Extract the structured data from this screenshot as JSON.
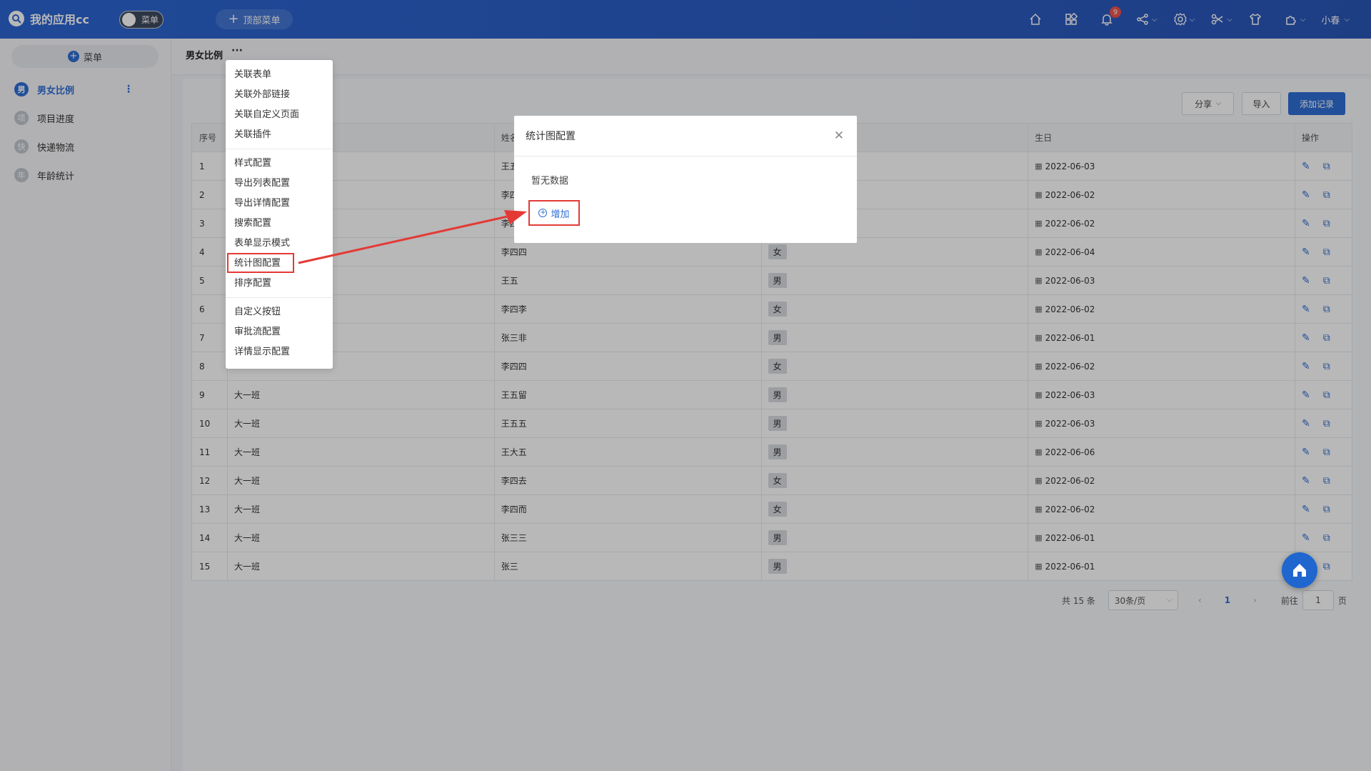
{
  "app": {
    "title": "我的应用cc",
    "toggle_label": "菜单",
    "top_menu_label": "顶部菜单",
    "notification_count": "9",
    "user_name": "小春"
  },
  "sidebar": {
    "menu_button": "菜单",
    "items": [
      {
        "avatar": "男",
        "label": "男女比例"
      },
      {
        "avatar": "项",
        "label": "项目进度"
      },
      {
        "avatar": "快",
        "label": "快递物流"
      },
      {
        "avatar": "年",
        "label": "年龄统计"
      }
    ]
  },
  "page": {
    "title": "男女比例",
    "more": "···"
  },
  "toolbar": {
    "share": "分享",
    "import": "导入",
    "add_record": "添加记录"
  },
  "table": {
    "headers": [
      "序号",
      "",
      "姓名",
      "",
      "生日",
      "操作"
    ],
    "rows": [
      {
        "no": "1",
        "class": "",
        "name": "王五",
        "gender": "",
        "birthday": "2022-06-03"
      },
      {
        "no": "2",
        "class": "",
        "name": "李四",
        "gender": "",
        "birthday": "2022-06-02"
      },
      {
        "no": "3",
        "class": "",
        "name": "李四",
        "gender": "",
        "birthday": "2022-06-02"
      },
      {
        "no": "4",
        "class": "",
        "name": "李四四",
        "gender": "女",
        "birthday": "2022-06-04"
      },
      {
        "no": "5",
        "class": "",
        "name": "王五",
        "gender": "男",
        "birthday": "2022-06-03"
      },
      {
        "no": "6",
        "class": "",
        "name": "李四李",
        "gender": "女",
        "birthday": "2022-06-02"
      },
      {
        "no": "7",
        "class": "",
        "name": "张三非",
        "gender": "男",
        "birthday": "2022-06-01"
      },
      {
        "no": "8",
        "class": "",
        "name": "李四四",
        "gender": "女",
        "birthday": "2022-06-02"
      },
      {
        "no": "9",
        "class": "大一班",
        "name": "王五留",
        "gender": "男",
        "birthday": "2022-06-03"
      },
      {
        "no": "10",
        "class": "大一班",
        "name": "王五五",
        "gender": "男",
        "birthday": "2022-06-03"
      },
      {
        "no": "11",
        "class": "大一班",
        "name": "王大五",
        "gender": "男",
        "birthday": "2022-06-06"
      },
      {
        "no": "12",
        "class": "大一班",
        "name": "李四去",
        "gender": "女",
        "birthday": "2022-06-02"
      },
      {
        "no": "13",
        "class": "大一班",
        "name": "李四而",
        "gender": "女",
        "birthday": "2022-06-02"
      },
      {
        "no": "14",
        "class": "大一班",
        "name": "张三三",
        "gender": "男",
        "birthday": "2022-06-01"
      },
      {
        "no": "15",
        "class": "大一班",
        "name": "张三",
        "gender": "男",
        "birthday": "2022-06-01"
      }
    ]
  },
  "pagination": {
    "total": "共 15 条",
    "page_size": "30条/页",
    "current": "1",
    "goto_prefix": "前往",
    "goto_value": "1",
    "goto_suffix": "页"
  },
  "context_menu": {
    "items": [
      "关联表单",
      "关联外部链接",
      "关联自定义页面",
      "关联插件",
      "样式配置",
      "导出列表配置",
      "导出详情配置",
      "搜索配置",
      "表单显示模式",
      "统计图配置",
      "排序配置",
      "自定义按钮",
      "审批流配置",
      "详情显示配置"
    ]
  },
  "modal": {
    "title": "统计图配置",
    "empty_text": "暂无数据",
    "add_label": "增加"
  },
  "colors": {
    "primary": "#2f6ed4",
    "highlight": "#e43a36",
    "topbar": "#2a5fc8"
  }
}
